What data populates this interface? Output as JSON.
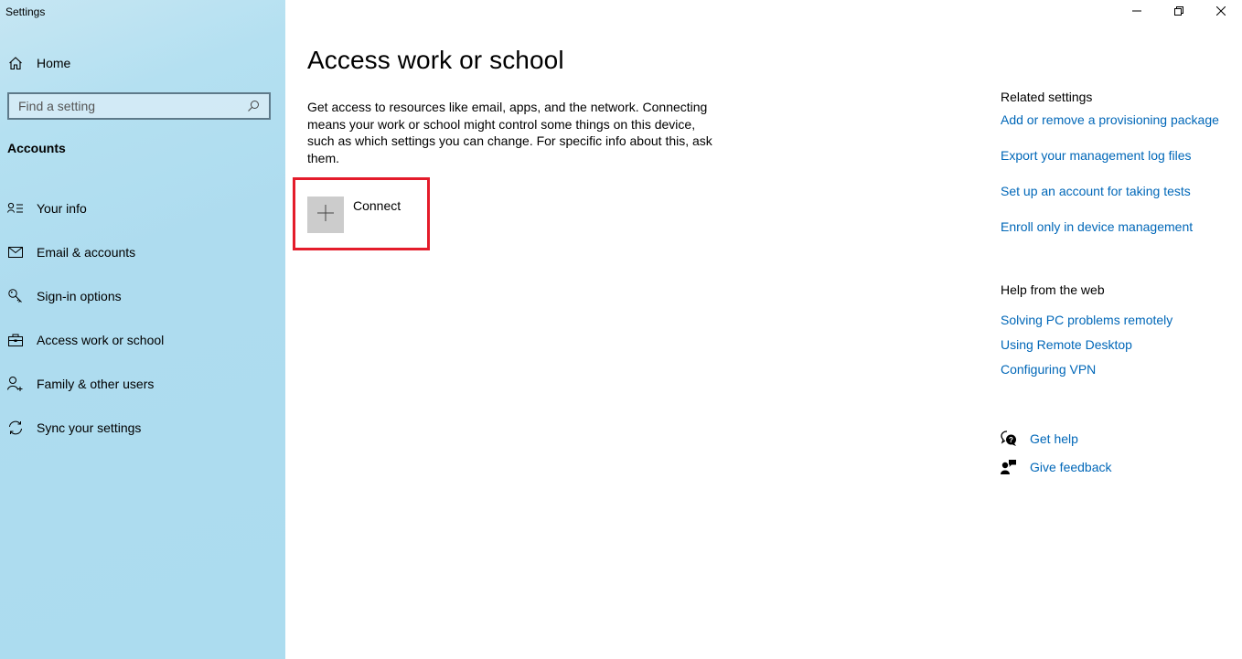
{
  "window": {
    "title": "Settings",
    "controls": {
      "minimize_icon": "minimize-icon",
      "restore_icon": "restore-icon",
      "close_icon": "close-icon"
    }
  },
  "sidebar": {
    "home": {
      "label": "Home",
      "icon": "home-icon"
    },
    "search": {
      "placeholder": "Find a setting",
      "value": "",
      "icon": "search-icon"
    },
    "section_title": "Accounts",
    "items": [
      {
        "label": "Your info",
        "icon": "person-list-icon"
      },
      {
        "label": "Email & accounts",
        "icon": "mail-icon"
      },
      {
        "label": "Sign-in options",
        "icon": "key-icon"
      },
      {
        "label": "Access work or school",
        "icon": "briefcase-icon"
      },
      {
        "label": "Family & other users",
        "icon": "person-add-icon"
      },
      {
        "label": "Sync your settings",
        "icon": "sync-icon"
      }
    ]
  },
  "main": {
    "title": "Access work or school",
    "description": "Get access to resources like email, apps, and the network. Connecting means your work or school might control some things on this device, such as which settings you can change. For specific info about this, ask them.",
    "connect": {
      "label": "Connect",
      "icon": "plus-icon"
    },
    "highlight_color": "#e41c2b"
  },
  "related_settings": {
    "heading": "Related settings",
    "links": [
      "Add or remove a provisioning package",
      "Export your management log files",
      "Set up an account for taking tests",
      "Enroll only in device management"
    ]
  },
  "help_from_web": {
    "heading": "Help from the web",
    "links": [
      "Solving PC problems remotely",
      "Using Remote Desktop",
      "Configuring VPN"
    ]
  },
  "support": {
    "get_help": "Get help",
    "give_feedback": "Give feedback"
  },
  "colors": {
    "link": "#0067b8",
    "sidebar_bg": "#acdcef",
    "connect_tile": "#cccccc"
  }
}
